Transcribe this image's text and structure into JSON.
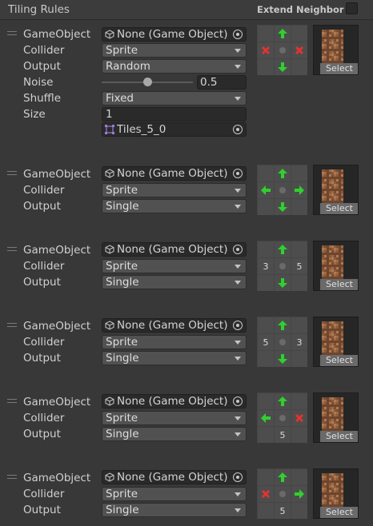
{
  "header": {
    "title": "Tiling Rules",
    "extend_label": "Extend Neighbor"
  },
  "labels": {
    "gameobject": "GameObject",
    "collider": "Collider",
    "output": "Output",
    "noise": "Noise",
    "shuffle": "Shuffle",
    "size": "Size",
    "select": "Select"
  },
  "rule1": {
    "gameobject": "None (Game Object)",
    "collider": "Sprite",
    "output": "Random",
    "noise_value": "0.5",
    "noise_fraction": 0.5,
    "shuffle": "Fixed",
    "size": "1",
    "sprite": "Tiles_5_0",
    "neighbors": [
      "",
      "up-arrow",
      "",
      "x",
      "",
      "x",
      "",
      "down-arrow",
      ""
    ]
  },
  "rule2": {
    "gameobject": "None (Game Object)",
    "collider": "Sprite",
    "output": "Single",
    "neighbors": [
      "",
      "up-arrow",
      "",
      "left-arrow",
      "",
      "right-arrow",
      "",
      "down-arrow",
      ""
    ]
  },
  "rule3": {
    "gameobject": "None (Game Object)",
    "collider": "Sprite",
    "output": "Single",
    "neighbors": [
      "",
      "up-arrow",
      "",
      "3",
      "",
      "5",
      "",
      "down-arrow",
      ""
    ]
  },
  "rule4": {
    "gameobject": "None (Game Object)",
    "collider": "Sprite",
    "output": "Single",
    "neighbors": [
      "",
      "up-arrow",
      "",
      "5",
      "",
      "3",
      "",
      "down-arrow",
      ""
    ]
  },
  "rule5": {
    "gameobject": "None (Game Object)",
    "collider": "Sprite",
    "output": "Single",
    "neighbors": [
      "",
      "up-arrow",
      "",
      "left-arrow",
      "",
      "x",
      "",
      "5",
      ""
    ]
  },
  "rule6": {
    "gameobject": "None (Game Object)",
    "collider": "Sprite",
    "output": "Single",
    "neighbors": [
      "",
      "up-arrow",
      "",
      "x",
      "",
      "right-arrow",
      "",
      "5",
      ""
    ]
  },
  "colors": {
    "arrow": "#2ed12e",
    "x": "#e03333",
    "background": "#383838"
  }
}
